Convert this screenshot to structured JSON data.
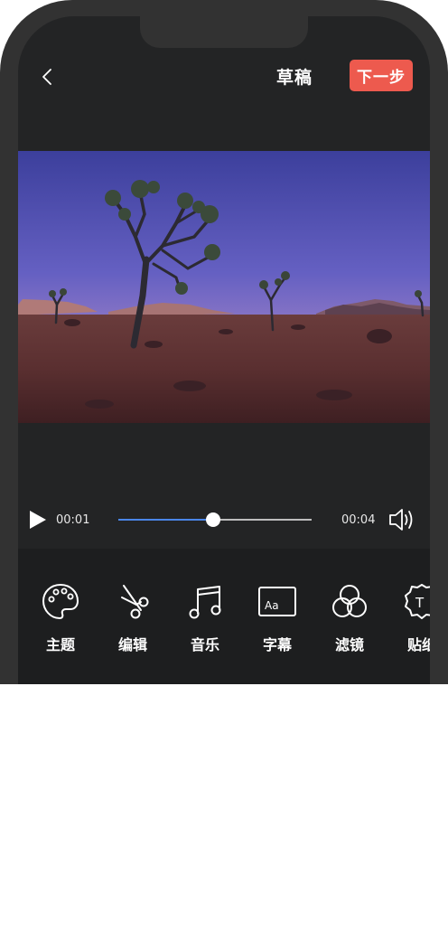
{
  "header": {
    "title": "草稿",
    "next_label": "下一步"
  },
  "player": {
    "current_time": "00:01",
    "total_time": "00:04",
    "progress": 0.49
  },
  "tools": [
    {
      "label": "主题",
      "icon": "palette-icon"
    },
    {
      "label": "编辑",
      "icon": "scissors-icon"
    },
    {
      "label": "音乐",
      "icon": "music-note-icon"
    },
    {
      "label": "字幕",
      "icon": "subtitle-icon"
    },
    {
      "label": "滤镜",
      "icon": "filter-icon"
    },
    {
      "label": "贴纸",
      "icon": "sticker-icon"
    }
  ],
  "colors": {
    "accent": "#ed5a4e",
    "progress": "#4a86e8"
  }
}
